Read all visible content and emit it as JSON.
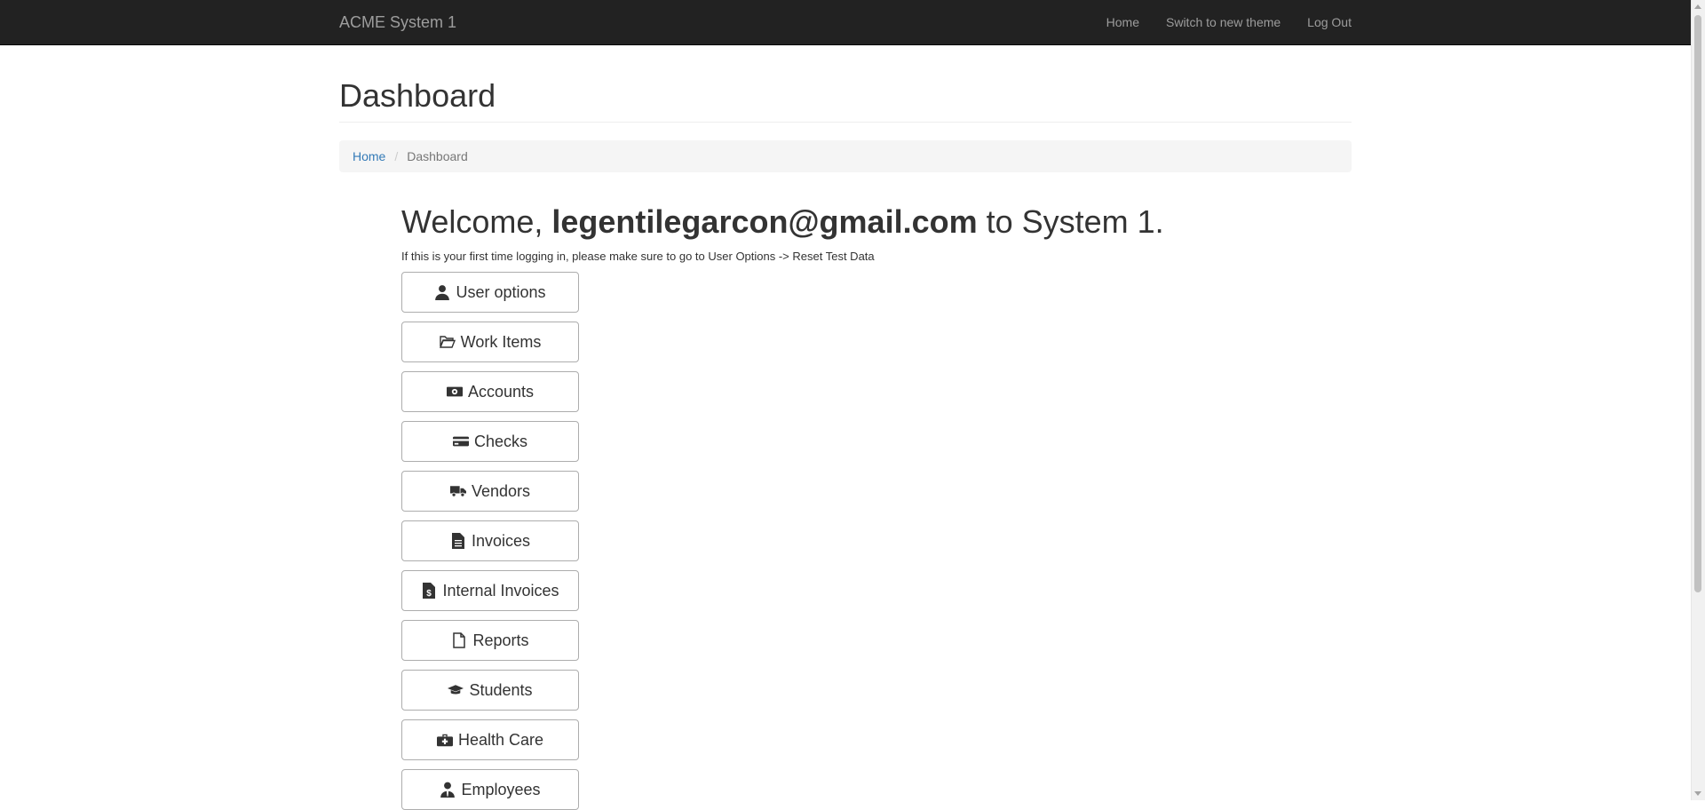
{
  "navbar": {
    "brand": "ACME System 1",
    "links": [
      "Home",
      "Switch to new theme",
      "Log Out"
    ]
  },
  "page": {
    "title": "Dashboard"
  },
  "breadcrumb": {
    "home": "Home",
    "current": "Dashboard"
  },
  "welcome": {
    "prefix": "Welcome, ",
    "user": "legentilegarcon@gmail.com",
    "suffix": " to System 1.",
    "note": "If this is your first time logging in, please make sure to go to User Options -> Reset Test Data"
  },
  "menu": [
    {
      "label": "User options",
      "icon": "user-icon"
    },
    {
      "label": "Work Items",
      "icon": "folder-open-icon"
    },
    {
      "label": "Accounts",
      "icon": "money-icon"
    },
    {
      "label": "Checks",
      "icon": "credit-card-icon"
    },
    {
      "label": "Vendors",
      "icon": "truck-icon"
    },
    {
      "label": "Invoices",
      "icon": "file-text-icon"
    },
    {
      "label": "Internal Invoices",
      "icon": "file-invoice-dollar-icon"
    },
    {
      "label": "Reports",
      "icon": "file-icon"
    },
    {
      "label": "Students",
      "icon": "graduation-cap-icon"
    },
    {
      "label": "Health Care",
      "icon": "medkit-icon"
    },
    {
      "label": "Employees",
      "icon": "user-tie-icon"
    }
  ],
  "colors": {
    "navbar_bg": "#222222",
    "nav_text": "#9d9d9d",
    "link": "#337ab7",
    "breadcrumb_bg": "#f5f5f5"
  }
}
